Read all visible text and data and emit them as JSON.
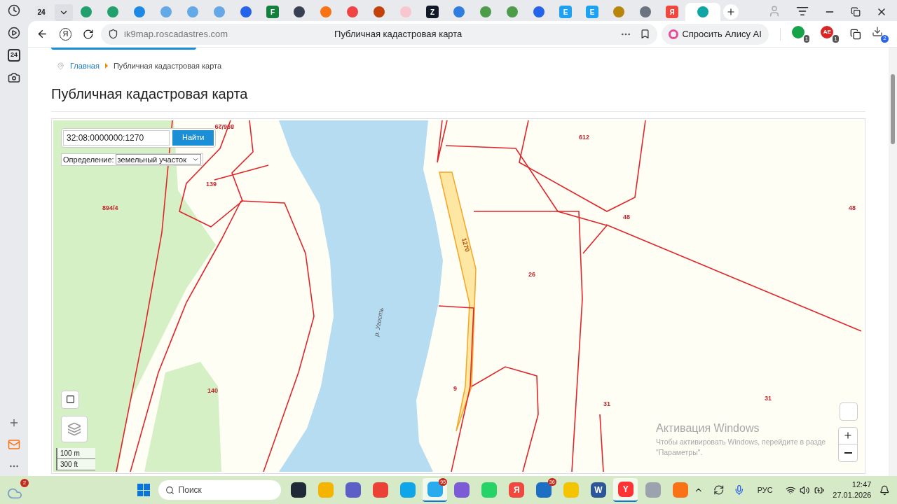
{
  "browser_tabs": [
    {
      "label": "24",
      "color": "#e5e7eb",
      "selected": false
    },
    {
      "color": "#22a06b",
      "selected": false
    },
    {
      "color": "#22a06b",
      "selected": false
    },
    {
      "color": "#1e88e5",
      "selected": false
    },
    {
      "color": "#64a8e8",
      "selected": false
    },
    {
      "color": "#64a8e8",
      "selected": false
    },
    {
      "color": "#64a8e8",
      "selected": false
    },
    {
      "color": "#2563eb",
      "selected": false
    },
    {
      "label": "F",
      "color": "#15803d",
      "selected": false
    },
    {
      "color": "#374151",
      "selected": false
    },
    {
      "color": "#f97316",
      "selected": false
    },
    {
      "color": "#ef4444",
      "selected": false
    },
    {
      "color": "#c2410c",
      "selected": false
    },
    {
      "color": "#f9c5cf",
      "selected": false
    },
    {
      "label": "Z",
      "color": "#111827",
      "selected": false
    },
    {
      "color": "#2f7de1",
      "selected": false
    },
    {
      "color": "#4d9c4a",
      "selected": false
    },
    {
      "color": "#4d9c4a",
      "selected": false
    },
    {
      "color": "#2563eb",
      "selected": false
    },
    {
      "label": "E",
      "color": "#1da1f2",
      "selected": false
    },
    {
      "label": "E",
      "color": "#1da1f2",
      "selected": false
    },
    {
      "color": "#b8860b",
      "selected": false
    },
    {
      "color": "#6b7280",
      "selected": false
    },
    {
      "label": "Я",
      "color": "#f0483e",
      "selected": false
    },
    {
      "color": "#0ea5a4",
      "selected": true
    }
  ],
  "sidebar": {
    "label": "24"
  },
  "address_bar": {
    "yandex_label": "Я",
    "url": "ik9map.roscadastres.com",
    "page_title": "Публичная кадастровая карта",
    "alice_button": "Спросить Алису AI"
  },
  "extensions": [
    {
      "color": "#16a34a",
      "badge": "1"
    },
    {
      "label": "AE",
      "color": "#dc2626",
      "badge": "1"
    }
  ],
  "downloads_badge": "2",
  "breadcrumb": [
    {
      "label": "Главная",
      "kind": "link"
    },
    {
      "label": "Публичная кадастровая карта",
      "kind": "current"
    }
  ],
  "heading": "Публичная кадастровая карта",
  "map": {
    "search": {
      "value": "32:08:0000000:1270",
      "button": "Найти"
    },
    "definition": {
      "label": "Определение:",
      "value": "земельный участок"
    },
    "parcel_labels": [
      {
        "text": "896/29",
        "kind": "cut"
      },
      {
        "text": "894/4",
        "kind": "plain"
      },
      {
        "text": "139",
        "kind": "plain"
      },
      {
        "text": "612",
        "kind": "plain"
      },
      {
        "text": "48",
        "kind": "plain"
      },
      {
        "text": "48",
        "kind": "plain"
      },
      {
        "text": "1270",
        "kind": "selected"
      },
      {
        "text": "26",
        "kind": "plain"
      },
      {
        "text": "р. Угость",
        "kind": "river"
      },
      {
        "text": "140",
        "kind": "plain"
      },
      {
        "text": "9",
        "kind": "plain"
      },
      {
        "text": "31",
        "kind": "plain"
      },
      {
        "text": "31",
        "kind": "plain"
      }
    ],
    "scale": [
      "100 m",
      "300 ft"
    ]
  },
  "activation": {
    "title": "Активация Windows",
    "text": "Чтобы активировать Windows, перейдите в разде",
    "text2": "\"Параметры\"."
  },
  "taskbar": {
    "weather_badge": "2",
    "search_placeholder": "Поиск",
    "apps": [
      {
        "color": "#1f2937",
        "selected": false
      },
      {
        "color": "#f5b400",
        "selected": false
      },
      {
        "color": "#5b5fc7",
        "selected": false
      },
      {
        "color": "#ea4335",
        "selected": false
      },
      {
        "color": "#0ea5e9",
        "selected": false
      },
      {
        "color": "#2aabee",
        "selected": true,
        "badge": "95"
      },
      {
        "color": "#7b5cd6",
        "selected": false
      },
      {
        "color": "#25d366",
        "selected": false
      },
      {
        "label": "Я",
        "color": "#f0483e",
        "selected": false
      },
      {
        "color": "#1d6fc4",
        "selected": false,
        "badge": "36"
      },
      {
        "color": "#f5c400",
        "selected": false
      },
      {
        "label": "W",
        "color": "#2b579a",
        "selected": false
      },
      {
        "label": "Y",
        "color": "#ff3333",
        "selected": true
      },
      {
        "color": "#9ca3af",
        "selected": false
      },
      {
        "color": "#f97316",
        "selected": false
      }
    ],
    "language": "РУС",
    "time": "12:47",
    "date": "27.01.2026"
  }
}
